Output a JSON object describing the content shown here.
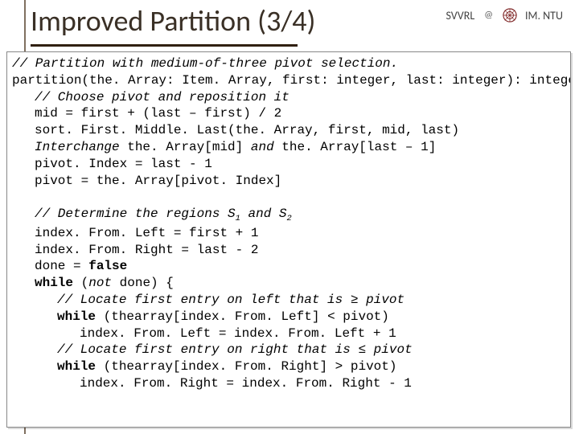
{
  "slide": {
    "title": "Improved Partition (3/4)",
    "header": {
      "left_label": "SVVRL",
      "right_label": "IM. NTU"
    },
    "code": {
      "c1": "// Partition with medium-of-three pivot selection.",
      "sig": "partition(the. Array: Item. Array, first: integer, last: integer): integer",
      "c2": "// Choose pivot and reposition it",
      "l1": "mid = first + (last – first) / 2",
      "l2": "sort. First. Middle. Last(the. Array, first, mid, last)",
      "l3_pre": "Interchange",
      "l3_mid": " the. Array[mid] ",
      "l3_and": "and",
      "l3_post": " the. Array[last – 1]",
      "l4": "pivot. Index = last - 1",
      "l5": "pivot = the. Array[pivot. Index]",
      "c3_pre": "// Determine the regions S",
      "c3_mid": " and S",
      "l6": "index. From. Left = first + 1",
      "l7": "index. From. Right = last - 2",
      "l8_a": "done = ",
      "l8_b": "false",
      "l9_a": "while",
      "l9_b": " (",
      "l9_c": "not",
      "l9_d": " done) {",
      "c4": "// Locate first entry on left that is ≥ pivot",
      "l10_a": "while",
      "l10_b": " (thearray[index. From. Left] < pivot)",
      "l11": "index. From. Left = index. From. Left + 1",
      "c5": "// Locate first entry on right that is ≤ pivot",
      "l12_a": "while",
      "l12_b": " (thearray[index. From. Right] > pivot)",
      "l13": "index. From. Right = index. From. Right - 1"
    }
  }
}
